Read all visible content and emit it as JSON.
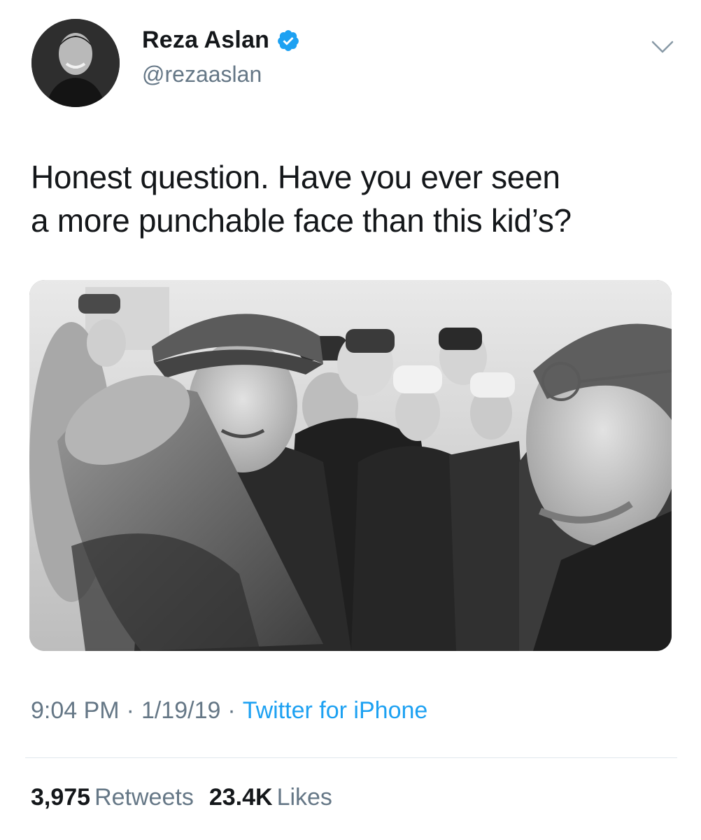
{
  "author": {
    "display_name": "Reza Aslan",
    "handle": "@rezaaslan",
    "verified": true,
    "verified_color": "#1da1f2"
  },
  "tweet": {
    "text_line_1": "Honest question. Have you ever seen",
    "text_line_2": "a more punchable face than this kid’s?"
  },
  "meta": {
    "time": "9:04 PM",
    "separator": "·",
    "date": "1/19/19",
    "source": "Twitter for iPhone"
  },
  "stats": {
    "retweets_count": "3,975",
    "retweets_label": "Retweets",
    "likes_count": "23.4K",
    "likes_label": "Likes"
  },
  "icons": {
    "verified": "verified-badge-icon",
    "menu": "chevron-down-icon"
  },
  "colors": {
    "text_primary": "#14171a",
    "text_secondary": "#657786",
    "link": "#1da1f2",
    "divider": "#e1e8ed"
  }
}
